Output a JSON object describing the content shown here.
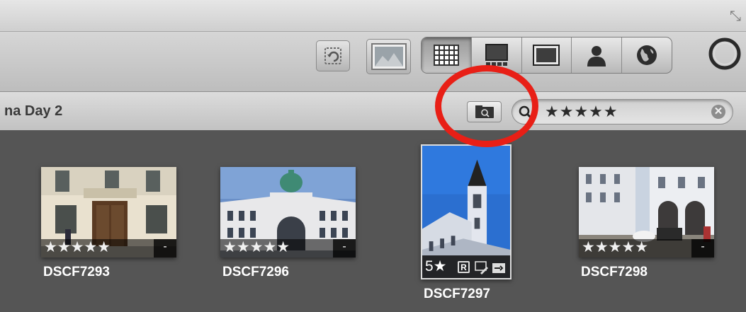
{
  "toolbar": {
    "views": [
      "grid-view",
      "split-view",
      "viewer",
      "faces",
      "places"
    ],
    "active_view": "grid-view"
  },
  "pathbar": {
    "album_title": "na Day 2"
  },
  "search": {
    "query": "★★★★★",
    "clear_symbol": "✕"
  },
  "photos": [
    {
      "name": "DSCF7293",
      "rating": "★★★★★",
      "more": "-"
    },
    {
      "name": "DSCF7296",
      "rating": "★★★★★",
      "more": "-"
    },
    {
      "name": "DSCF7297",
      "rating": "5★",
      "badge": "R"
    },
    {
      "name": "DSCF7298",
      "rating": "★★★★★",
      "more": "-"
    }
  ],
  "colors": {
    "annotation": "#e81f16",
    "browser_background": "#555555"
  }
}
